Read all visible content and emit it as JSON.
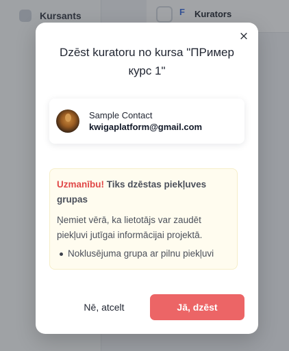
{
  "background": {
    "sidebar_item_label": "Kursants",
    "tab_flag": "F",
    "tab_label": "Kurators"
  },
  "modal": {
    "close_label": "×",
    "title": "Dzēst kuratoru no kursa \"ПРимер курс 1\"",
    "contact": {
      "name": "Sample Contact",
      "email": "kwigaplatform@gmail.com"
    },
    "alert": {
      "warning_label": "Uzmanību!",
      "heading": "Tiks dzēstas piekļuves grupas",
      "body": "Ņemiet vērā, ka lietotājs var zaudēt piekļuvi jutīgai informācijai projektā.",
      "groups": [
        "Noklusējuma grupa ar pilnu piekļuvi"
      ]
    },
    "cancel_label": "Nē, atcelt",
    "confirm_label": "Jā, dzēst"
  },
  "colors": {
    "confirm_button": "#ec6566",
    "warning_text": "#e04848",
    "alert_background": "#fffcef"
  }
}
